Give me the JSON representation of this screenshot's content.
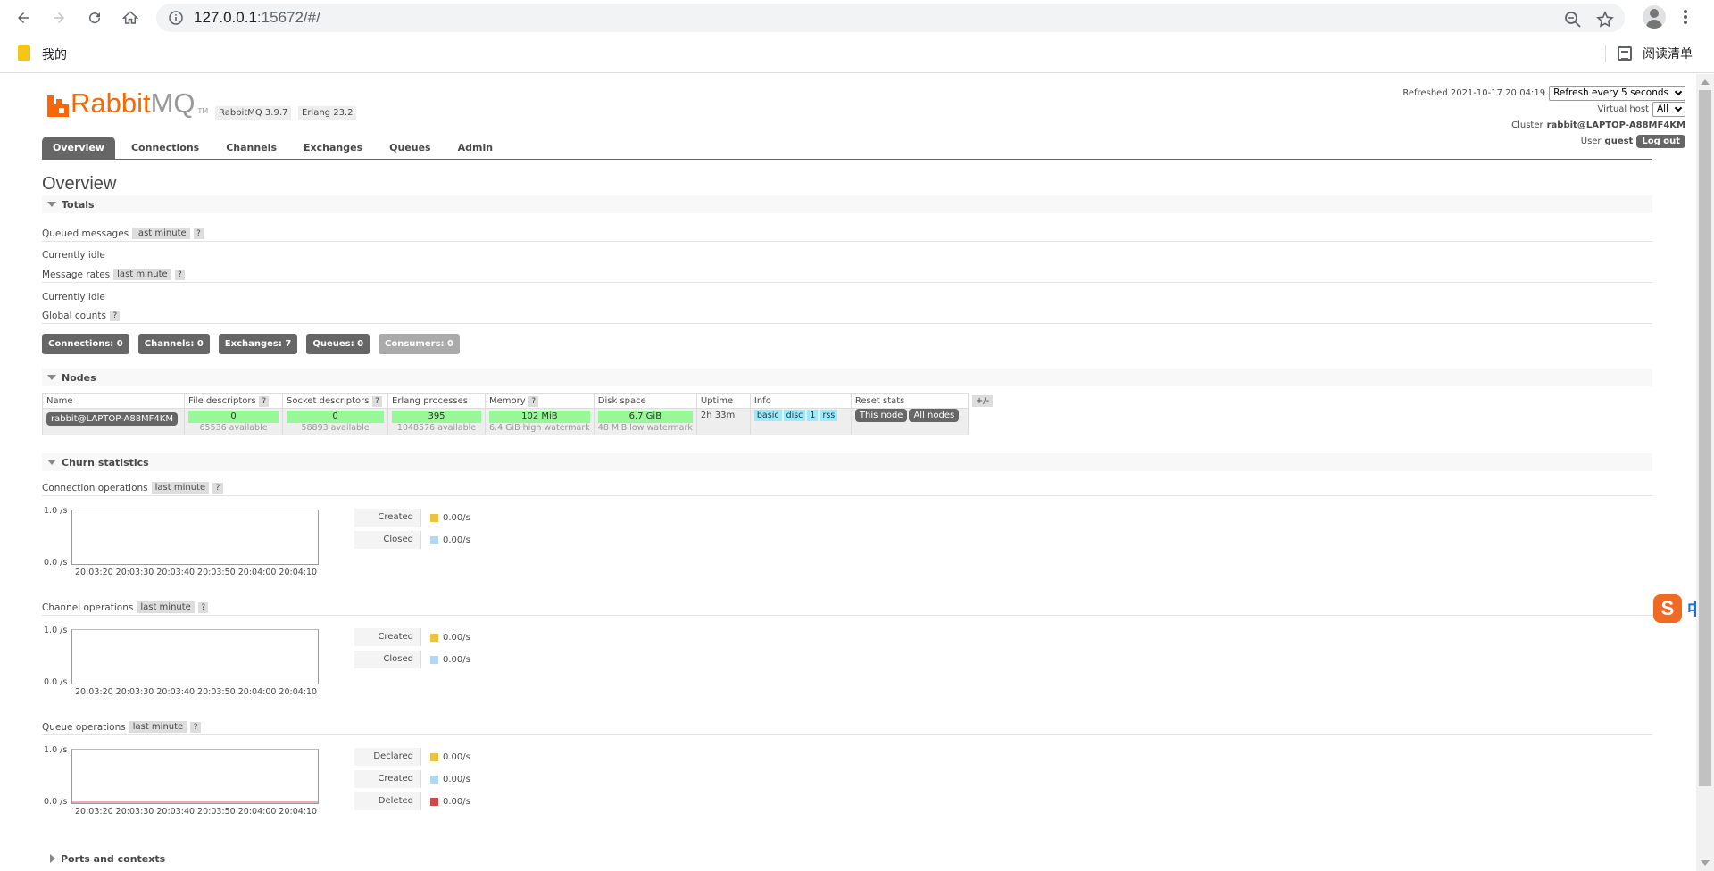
{
  "browser": {
    "url_host": "127.0.0.1",
    "url_rest": ":15672/#/",
    "bookmark_label": "我的",
    "reading_list_label": "阅读清单"
  },
  "header": {
    "logo_rabbit": "Rabbit",
    "logo_mq": "MQ",
    "logo_tm": "TM",
    "version": "RabbitMQ 3.9.7",
    "erlang": "Erlang 23.2",
    "refreshed_label": "Refreshed 2021-10-17 20:04:19",
    "refresh_select": "Refresh every 5 seconds",
    "vhost_label": "Virtual host",
    "vhost_select": "All",
    "cluster_label": "Cluster",
    "cluster_name": "rabbit@LAPTOP-A88MF4KM",
    "user_label": "User",
    "user_name": "guest",
    "logout": "Log out"
  },
  "tabs": [
    "Overview",
    "Connections",
    "Channels",
    "Exchanges",
    "Queues",
    "Admin"
  ],
  "page_title": "Overview",
  "totals": {
    "heading": "Totals",
    "queued_label": "Queued messages",
    "queued_range": "last minute",
    "help": "?",
    "idle1": "Currently idle",
    "rates_label": "Message rates",
    "rates_range": "last minute",
    "idle2": "Currently idle",
    "global_label": "Global counts"
  },
  "counts": [
    "Connections: 0",
    "Channels: 0",
    "Exchanges: 7",
    "Queues: 0",
    "Consumers: 0"
  ],
  "nodes": {
    "heading": "Nodes",
    "columns": [
      "Name",
      "File descriptors",
      "Socket descriptors",
      "Erlang processes",
      "Memory",
      "Disk space",
      "Uptime",
      "Info",
      "Reset stats"
    ],
    "plusminus": "+/-",
    "name": "rabbit@LAPTOP-A88MF4KM",
    "fd": "0",
    "fd_avail": "65536 available",
    "sd": "0",
    "sd_avail": "58893 available",
    "ep": "395",
    "ep_avail": "1048576 available",
    "mem": "102 MiB",
    "mem_wm": "6.4 GiB high watermark",
    "disk": "6.7 GiB",
    "disk_wm": "48 MiB low watermark",
    "uptime": "2h 33m",
    "info_tags": [
      "basic",
      "disc",
      "1",
      "rss"
    ],
    "reset_this": "This node",
    "reset_all": "All nodes"
  },
  "churn": {
    "heading": "Churn statistics",
    "conn_label": "Connection operations",
    "chan_label": "Channel operations",
    "queue_label": "Queue operations",
    "range": "last minute",
    "y_top": "1.0 /s",
    "y_bot": "0.0 /s",
    "x_ticks": "20:03:20 20:03:30 20:03:40 20:03:50 20:04:00 20:04:10",
    "created": "Created",
    "closed": "Closed",
    "declared": "Declared",
    "deleted": "Deleted",
    "rate": "0.00/s"
  },
  "colors": {
    "yellow": "#edc240",
    "lightblue": "#afd8f8",
    "red": "#cb4b4b"
  },
  "ports_heading": "Ports and contexts",
  "ime": {
    "logo": "S",
    "mode": "中"
  }
}
